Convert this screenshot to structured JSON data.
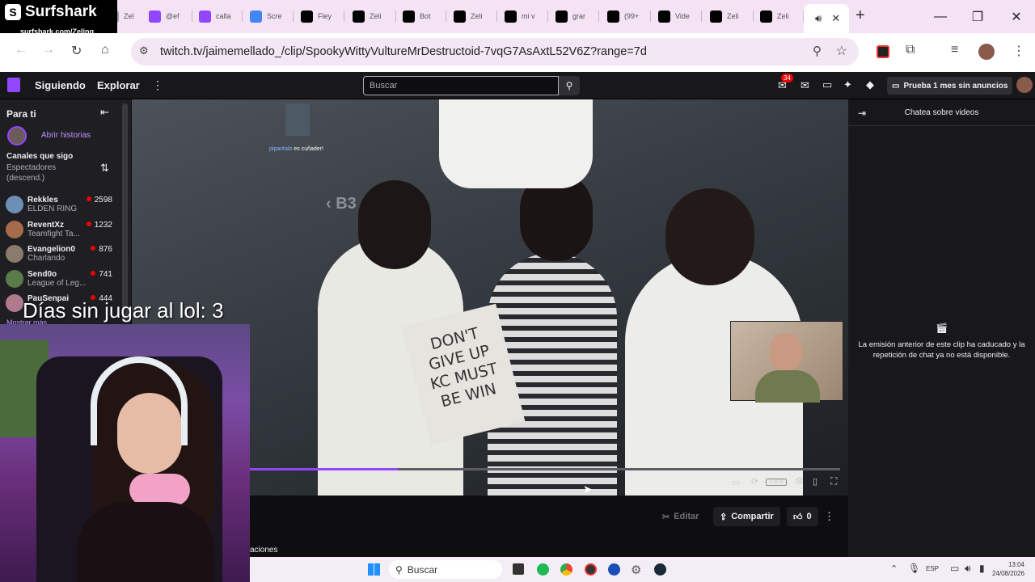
{
  "browser": {
    "vpn_overlay": {
      "brand": "Surfshark",
      "url": "surfshark.com/Zeling"
    },
    "tabs": [
      {
        "label": "Zel",
        "icon": "generic-icon",
        "color": "#9aa0a6"
      },
      {
        "label": "@ef",
        "icon": "twitch-icon",
        "color": "#9146ff"
      },
      {
        "label": "calla",
        "icon": "twitch-icon",
        "color": "#9146ff"
      },
      {
        "label": "Scre",
        "icon": "translate-icon",
        "color": "#4285f4"
      },
      {
        "label": "Fley",
        "icon": "x-icon",
        "color": "#000000"
      },
      {
        "label": "Zeli",
        "icon": "tiktok-icon",
        "color": "#000000"
      },
      {
        "label": "Bot",
        "icon": "tiktok-icon",
        "color": "#000000"
      },
      {
        "label": "Zeli",
        "icon": "tiktok-icon",
        "color": "#000000"
      },
      {
        "label": "mi v",
        "icon": "tiktok-icon",
        "color": "#000000"
      },
      {
        "label": "grar",
        "icon": "tiktok-icon",
        "color": "#000000"
      },
      {
        "label": "(99+",
        "icon": "tiktok-icon",
        "color": "#000000"
      },
      {
        "label": "Vide",
        "icon": "tiktok-icon",
        "color": "#000000"
      },
      {
        "label": "Zeli",
        "icon": "tiktok-icon",
        "color": "#000000"
      },
      {
        "label": "Zeli",
        "icon": "tiktok-icon",
        "color": "#000000"
      }
    ],
    "url": "twitch.tv/jaimemellado_/clip/SpookyWittyVultureMrDestructoid-7vqG7AsAxtL52V6Z?range=7d"
  },
  "twitch": {
    "nav": {
      "following": "Siguiendo",
      "browse": "Explorar"
    },
    "search_placeholder": "Buscar",
    "notifications_count": "34",
    "turbo_label": "Prueba 1 mes sin anuncios",
    "sidebar": {
      "title": "Para ti",
      "stories": "Abrir historias",
      "followed_header": "Canales que sigo",
      "sort_label": "Espectadores (descend.)",
      "channels": [
        {
          "name": "Rekkles",
          "game": "ELDEN RING",
          "viewers": "2598",
          "color": "#6b8fb5"
        },
        {
          "name": "ReventXz",
          "game": "Teamfight Ta...",
          "viewers": "1232",
          "color": "#a56b4a"
        },
        {
          "name": "Evangelion0",
          "game": "Charlando",
          "viewers": "876",
          "color": "#8a7b6a"
        },
        {
          "name": "Send0o",
          "game": "League of Leg...",
          "viewers": "741",
          "color": "#5b7a4a"
        },
        {
          "name": "PauSenpai",
          "game": "",
          "viewers": "444",
          "color": "#b07a8a"
        }
      ],
      "show_more": "Mostrar más"
    },
    "video": {
      "overlay_user": "piparitalo",
      "overlay_msg": "es cuñader!",
      "quality": "1080P"
    },
    "actions": {
      "edit": "Editar",
      "share": "Compartir",
      "likes": "0",
      "more_text": "aciones"
    },
    "chat": {
      "title": "Chatea sobre videos",
      "message": "La emisión anterior de este clip ha caducado y la repetición de chat ya no está disponible."
    }
  },
  "stream_overlay": {
    "text": "Días sin jugar al lol: 3"
  },
  "taskbar": {
    "search": "Buscar",
    "lang": "ESP",
    "time": "13:04",
    "date": "24/08/2026"
  }
}
